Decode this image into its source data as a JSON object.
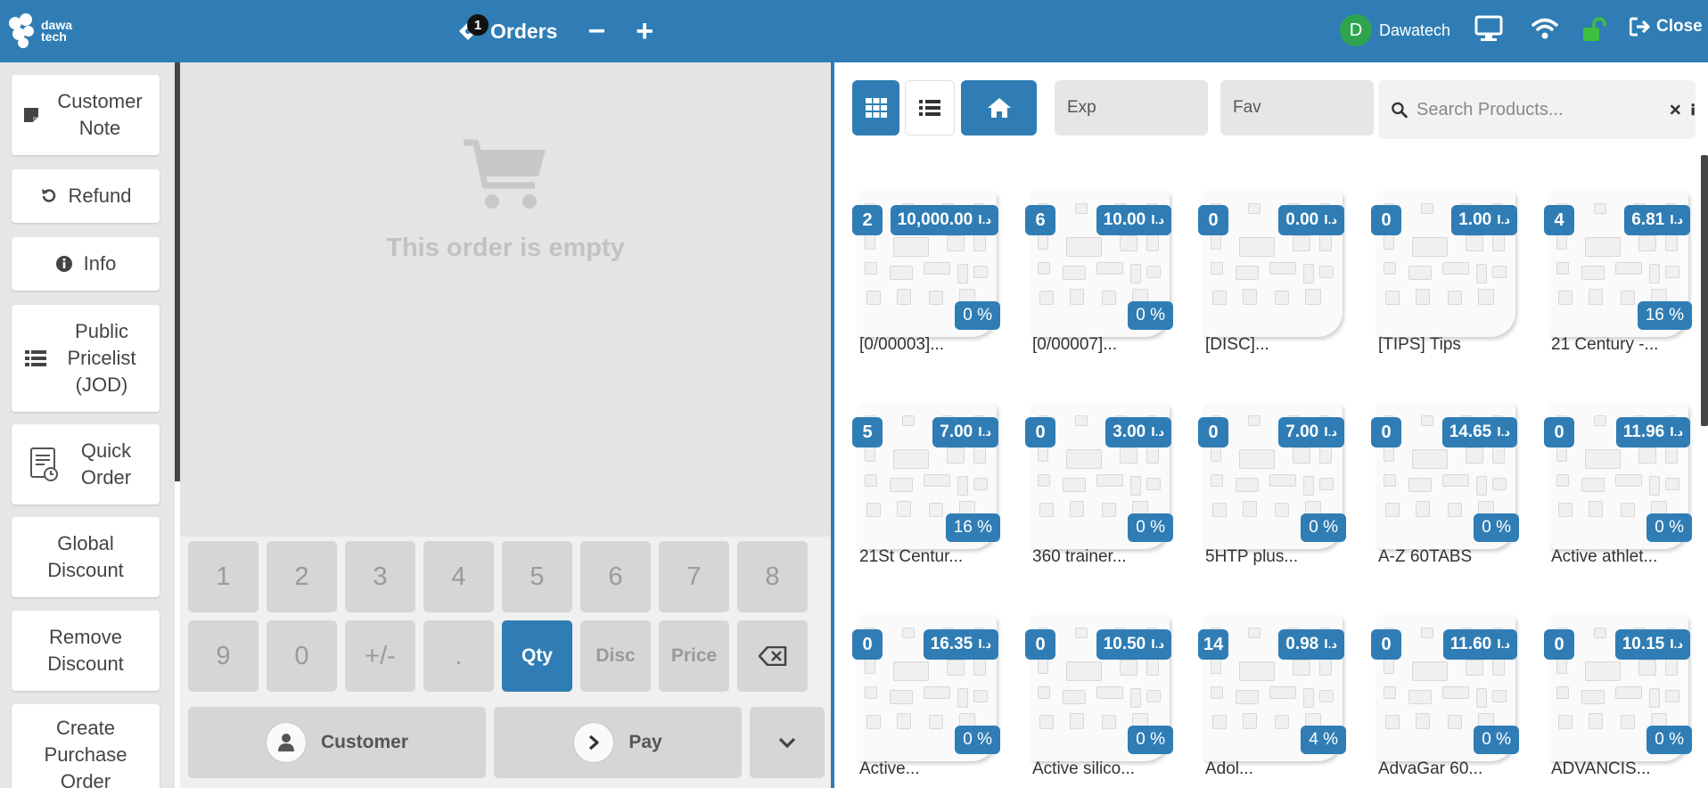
{
  "header": {
    "logo_text_1": "dawa",
    "logo_text_2": "tech",
    "orders_count": "1",
    "orders_label": "Orders",
    "minus_label": "−",
    "plus_label": "+",
    "user_initial": "D",
    "user_name": "Dawatech",
    "close_label": "Close"
  },
  "actions": [
    {
      "label": "Customer Note",
      "icon": "note-icon"
    },
    {
      "label": "Refund",
      "icon": "undo-icon"
    },
    {
      "label": "Info",
      "icon": "info-icon"
    },
    {
      "label": "Public Pricelist (JOD)",
      "icon": "list-icon"
    },
    {
      "label": "Quick Order",
      "icon": "quick-order-icon"
    },
    {
      "label": "Global Discount",
      "icon": ""
    },
    {
      "label": "Remove Discount",
      "icon": ""
    },
    {
      "label": "Create Purchase Order",
      "icon": ""
    }
  ],
  "order": {
    "empty_text": "This order is empty"
  },
  "numpad": {
    "row1": [
      "1",
      "2",
      "3",
      "4",
      "5",
      "6",
      "7",
      "8"
    ],
    "row2": [
      "9",
      "0",
      "+/-",
      "."
    ],
    "modes": [
      "Qty",
      "Disc",
      "Price"
    ],
    "active_mode": "Qty",
    "customer_label": "Customer",
    "pay_label": "Pay"
  },
  "categories": {
    "exp_label": "Exp",
    "fav_label": "Fav"
  },
  "search": {
    "placeholder": "Search Products..."
  },
  "currency": "د.ا",
  "colors": {
    "primary": "#2f7db4",
    "avatar": "#2ea44f",
    "lock": "#3fbf3f"
  },
  "products": [
    {
      "name": "[0/00003]...",
      "qty": "2",
      "price": "10,000.00",
      "discount": "0 %"
    },
    {
      "name": "[0/00007]...",
      "qty": "6",
      "price": "10.00",
      "discount": "0 %"
    },
    {
      "name": "[DISC]...",
      "qty": "0",
      "price": "0.00",
      "discount": ""
    },
    {
      "name": "[TIPS] Tips",
      "qty": "0",
      "price": "1.00",
      "discount": ""
    },
    {
      "name": "21 Century -...",
      "qty": "4",
      "price": "6.81",
      "discount": "16 %"
    },
    {
      "name": "21St Centur...",
      "qty": "5",
      "price": "7.00",
      "discount": "16 %"
    },
    {
      "name": "360 trainer...",
      "qty": "0",
      "price": "3.00",
      "discount": "0 %"
    },
    {
      "name": "5HTP plus...",
      "qty": "0",
      "price": "7.00",
      "discount": "0 %"
    },
    {
      "name": "A-Z 60TABS",
      "qty": "0",
      "price": "14.65",
      "discount": "0 %"
    },
    {
      "name": "Active athlet...",
      "qty": "0",
      "price": "11.96",
      "discount": "0 %"
    },
    {
      "name": "Active...",
      "qty": "0",
      "price": "16.35",
      "discount": "0 %"
    },
    {
      "name": "Active silico...",
      "qty": "0",
      "price": "10.50",
      "discount": "0 %"
    },
    {
      "name": "Adol...",
      "qty": "14",
      "price": "0.98",
      "discount": "4 %"
    },
    {
      "name": "AdvaGar 60...",
      "qty": "0",
      "price": "11.60",
      "discount": "0 %"
    },
    {
      "name": "ADVANCIS...",
      "qty": "0",
      "price": "10.15",
      "discount": "0 %"
    }
  ]
}
